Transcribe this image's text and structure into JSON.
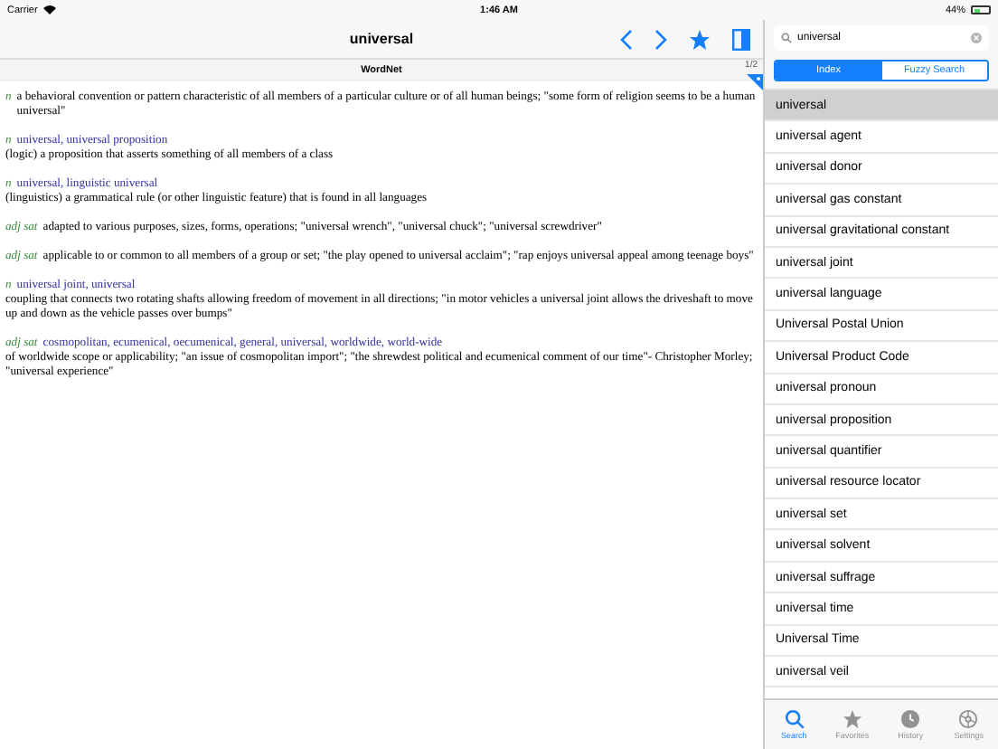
{
  "status_bar": {
    "carrier": "Carrier",
    "time": "1:46 AM",
    "battery": "44%"
  },
  "nav": {
    "title": "universal"
  },
  "source": {
    "name": "WordNet",
    "page": "1/2"
  },
  "entries": [
    {
      "pos": "n",
      "definition": "a behavioral convention or pattern characteristic of all members of a particular culture or of all human beings; \"some form of religion seems to be a human universal\""
    },
    {
      "pos": "n",
      "headwords": "universal, universal proposition",
      "definition": "(logic) a proposition that asserts something of all members of a class"
    },
    {
      "pos": "n",
      "headwords": "universal, linguistic universal",
      "definition": "(linguistics) a grammatical rule (or other linguistic feature) that is found in all languages"
    },
    {
      "pos": "adj sat",
      "definition": "adapted to various purposes, sizes, forms, operations; \"universal wrench\", \"universal chuck\"; \"universal screwdriver\""
    },
    {
      "pos": "adj sat",
      "definition": "applicable to or common to all members of a group or set; \"the play opened to universal acclaim\"; \"rap enjoys universal appeal among teenage boys\""
    },
    {
      "pos": "n",
      "headwords": "universal joint, universal",
      "definition": "coupling that connects two rotating shafts allowing freedom of movement in all directions; \"in motor vehicles a universal joint allows the driveshaft to move up and down as the vehicle passes over bumps\""
    },
    {
      "pos": "adj sat",
      "headwords": "cosmopolitan, ecumenical, oecumenical, general, universal, worldwide, world-wide",
      "definition": "of worldwide scope or applicability; \"an issue of cosmopolitan import\"; \"the shrewdest political and ecumenical comment of our time\"- Christopher Morley; \"universal experience\""
    }
  ],
  "search": {
    "value": "universal"
  },
  "segments": [
    {
      "label": "Index",
      "selected": true
    },
    {
      "label": "Fuzzy Search",
      "selected": false
    }
  ],
  "results": [
    {
      "label": "universal",
      "selected": true
    },
    {
      "label": "universal agent",
      "selected": false
    },
    {
      "label": "universal donor",
      "selected": false
    },
    {
      "label": "universal gas constant",
      "selected": false
    },
    {
      "label": "universal gravitational constant",
      "selected": false
    },
    {
      "label": "universal joint",
      "selected": false
    },
    {
      "label": "universal language",
      "selected": false
    },
    {
      "label": "Universal Postal Union",
      "selected": false
    },
    {
      "label": "Universal Product Code",
      "selected": false
    },
    {
      "label": "universal pronoun",
      "selected": false
    },
    {
      "label": "universal proposition",
      "selected": false
    },
    {
      "label": "universal quantifier",
      "selected": false
    },
    {
      "label": "universal resource locator",
      "selected": false
    },
    {
      "label": "universal set",
      "selected": false
    },
    {
      "label": "universal solvent",
      "selected": false
    },
    {
      "label": "universal suffrage",
      "selected": false
    },
    {
      "label": "universal time",
      "selected": false
    },
    {
      "label": "Universal Time",
      "selected": false
    },
    {
      "label": "universal veil",
      "selected": false
    }
  ],
  "tab_bar": [
    {
      "kind": "search",
      "label": "Search",
      "selected": true
    },
    {
      "kind": "favorites",
      "label": "Favorites",
      "selected": false
    },
    {
      "kind": "history",
      "label": "History",
      "selected": false
    },
    {
      "kind": "settings",
      "label": "Settings",
      "selected": false
    }
  ]
}
